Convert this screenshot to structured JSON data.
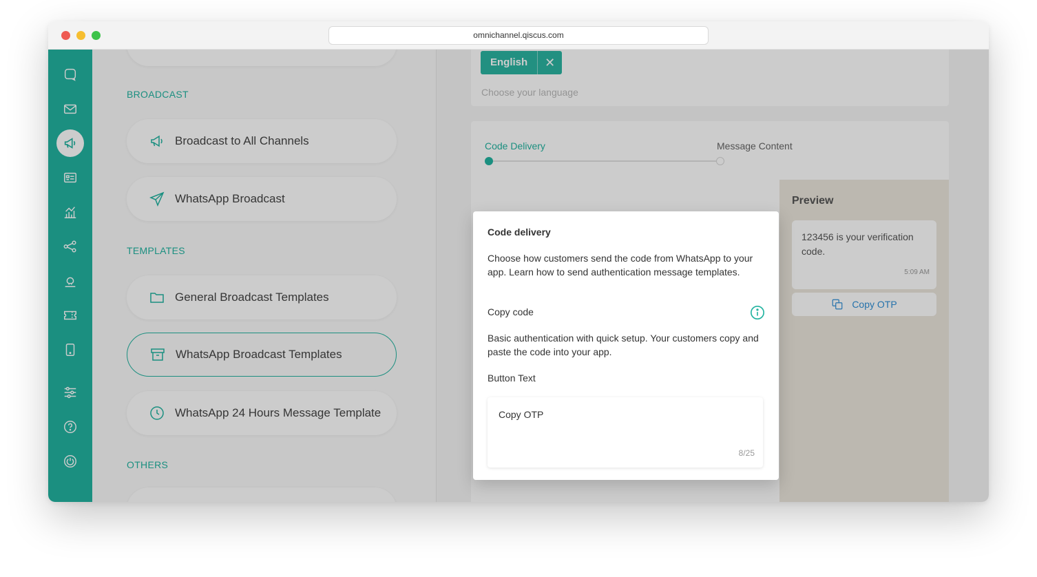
{
  "browser": {
    "url": "omnichannel.qiscus.com"
  },
  "colors": {
    "accent": "#22b3a0",
    "link": "#2f8fd6",
    "preview_bg": "#ece7dd"
  },
  "sidebar": {
    "icons": [
      "chat-icon",
      "mail-icon",
      "megaphone-icon",
      "contact-card-icon",
      "analytics-icon",
      "integration-icon",
      "agent-icon",
      "ticket-icon",
      "mobile-icon",
      "settings-sliders-icon",
      "help-icon",
      "power-icon"
    ],
    "active_icon": "megaphone-icon"
  },
  "menu": {
    "broadcast_label": "BROADCAST",
    "broadcast_items": [
      {
        "label": "Broadcast to All Channels",
        "icon": "megaphone-icon"
      },
      {
        "label": "WhatsApp Broadcast",
        "icon": "send-icon"
      }
    ],
    "templates_label": "TEMPLATES",
    "template_items": [
      {
        "label": "General Broadcast Templates",
        "icon": "folder-icon"
      },
      {
        "label": "WhatsApp Broadcast Templates",
        "icon": "archive-icon"
      },
      {
        "label": "WhatsApp 24 Hours Message Template",
        "icon": "clock-icon"
      }
    ],
    "others_label": "OTHERS"
  },
  "language": {
    "chip": "English",
    "remove_icon": "close-icon",
    "placeholder": "Choose your language"
  },
  "steps": {
    "step1": "Code Delivery",
    "step2": "Message Content"
  },
  "preview": {
    "title": "Preview",
    "message": "123456 is your verification code.",
    "time": "5:09 AM",
    "button": "Copy OTP"
  },
  "modal": {
    "title": "Code delivery",
    "description": "Choose how customers send the code from WhatsApp to your app. Learn how to send authentication message templates.",
    "option_title": "Copy code",
    "option_description": "Basic authentication with quick setup. Your customers copy and paste the code into your app.",
    "field_label": "Button Text",
    "field_value": "Copy OTP",
    "field_counter": "8/25"
  }
}
